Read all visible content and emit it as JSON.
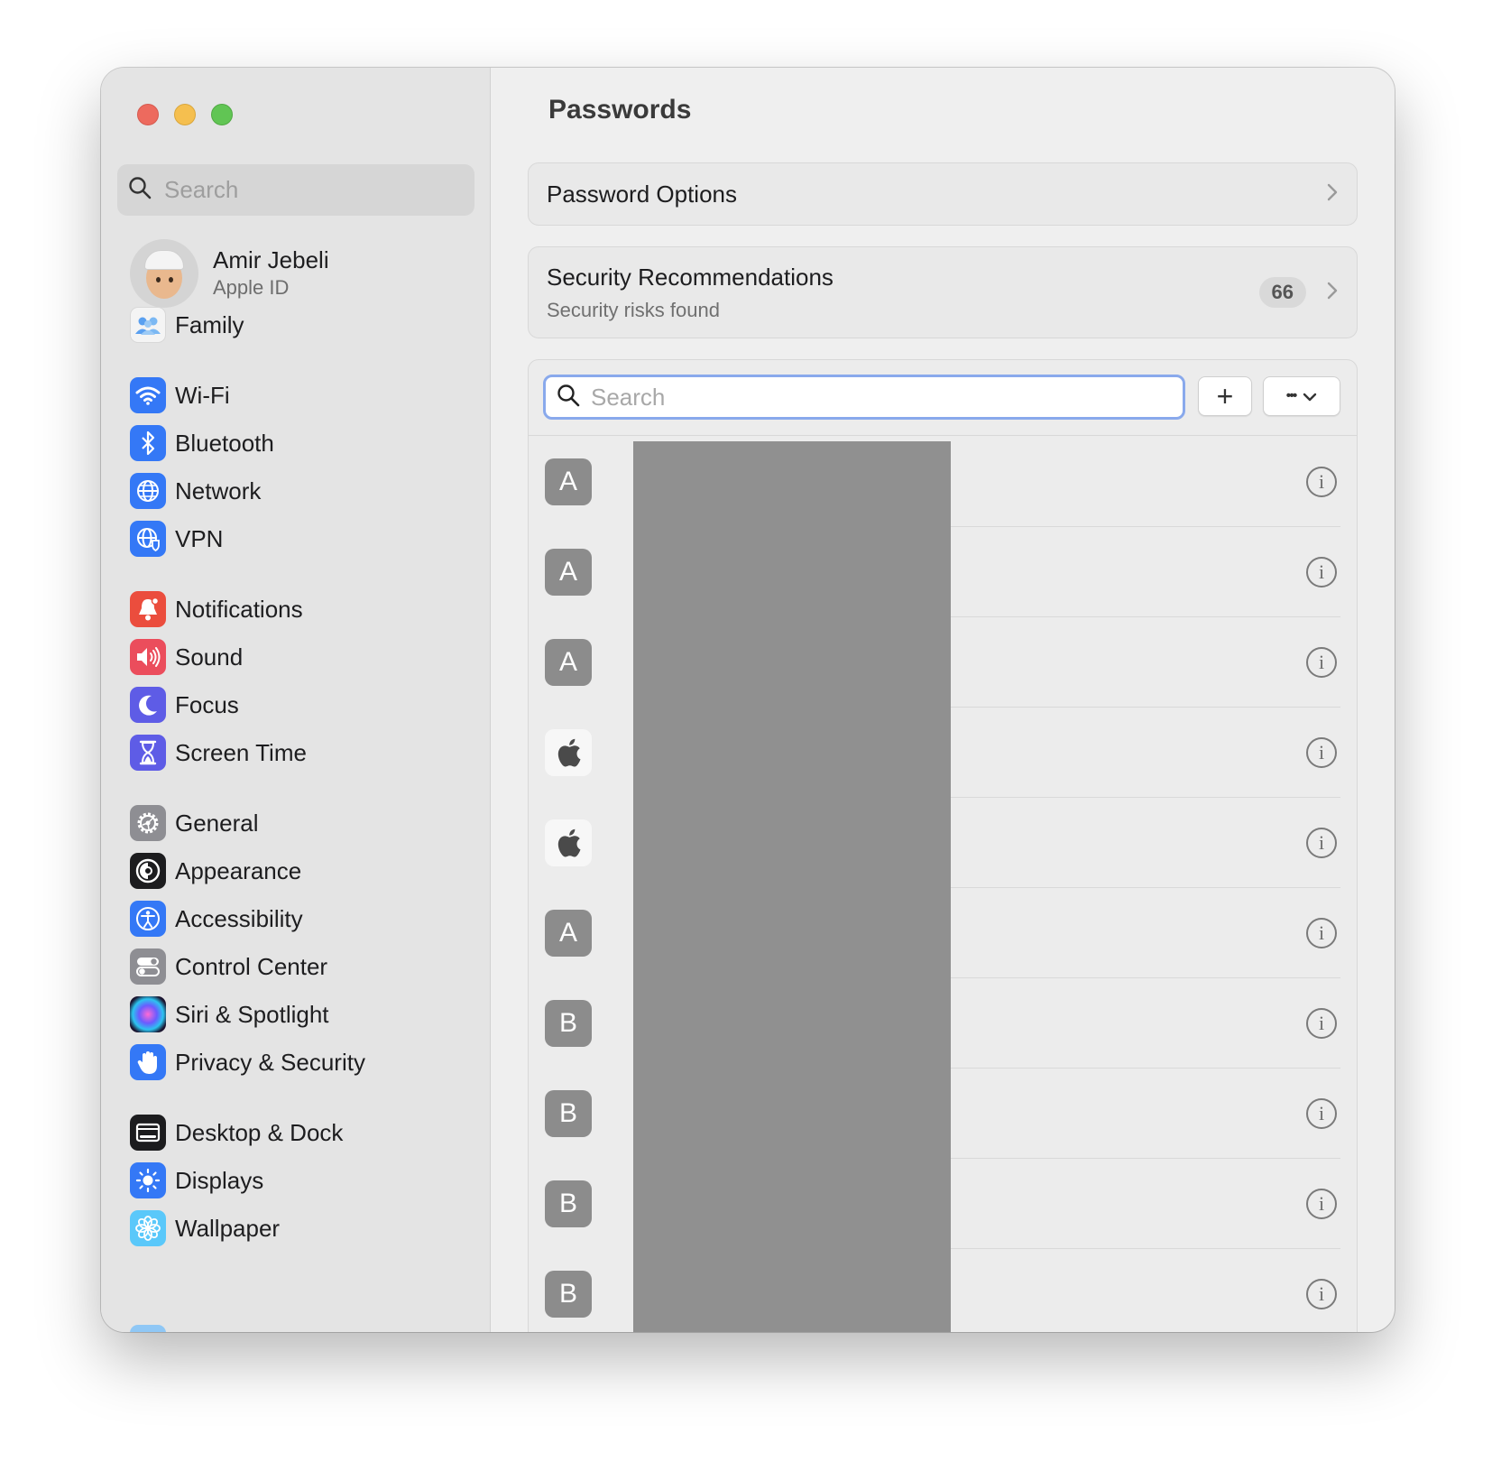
{
  "window": {
    "sidebar": {
      "search_placeholder": "Search",
      "account": {
        "name": "Amir Jebeli",
        "subtitle": "Apple ID"
      },
      "items": [
        {
          "label": "Family",
          "icon": "family-icon",
          "color": "#f2f2f2"
        },
        {
          "label": "Wi-Fi",
          "icon": "wifi-icon",
          "color": "#3478f6"
        },
        {
          "label": "Bluetooth",
          "icon": "bluetooth-icon",
          "color": "#3478f6"
        },
        {
          "label": "Network",
          "icon": "globe-icon",
          "color": "#3478f6"
        },
        {
          "label": "VPN",
          "icon": "vpn-globe-icon",
          "color": "#3478f6"
        },
        {
          "label": "Notifications",
          "icon": "bell-icon",
          "color": "#eb4d3d"
        },
        {
          "label": "Sound",
          "icon": "speaker-icon",
          "color": "#eb4d5c"
        },
        {
          "label": "Focus",
          "icon": "moon-icon",
          "color": "#5e5ce6"
        },
        {
          "label": "Screen Time",
          "icon": "hourglass-icon",
          "color": "#5e5ce6"
        },
        {
          "label": "General",
          "icon": "gear-icon",
          "color": "#8e8e93"
        },
        {
          "label": "Appearance",
          "icon": "appearance-icon",
          "color": "#1c1c1e"
        },
        {
          "label": "Accessibility",
          "icon": "accessibility-icon",
          "color": "#3478f6"
        },
        {
          "label": "Control Center",
          "icon": "toggles-icon",
          "color": "#8e8e93"
        },
        {
          "label": "Siri & Spotlight",
          "icon": "siri-icon",
          "color": "#3a1f5c"
        },
        {
          "label": "Privacy & Security",
          "icon": "hand-icon",
          "color": "#3478f6"
        },
        {
          "label": "Desktop & Dock",
          "icon": "dock-icon",
          "color": "#1c1c1e"
        },
        {
          "label": "Displays",
          "icon": "sun-icon",
          "color": "#3478f6"
        },
        {
          "label": "Wallpaper",
          "icon": "flower-icon",
          "color": "#5ac8fa"
        }
      ]
    },
    "main": {
      "title": "Passwords",
      "password_options": {
        "label": "Password Options"
      },
      "security": {
        "title": "Security Recommendations",
        "subtitle": "Security risks found",
        "count": "66"
      },
      "search_placeholder": "Search",
      "add_label": "+",
      "more_label": "•••",
      "rows": [
        {
          "letter": "A",
          "type": "letter"
        },
        {
          "letter": "A",
          "type": "letter"
        },
        {
          "letter": "A",
          "type": "letter"
        },
        {
          "letter": "",
          "type": "apple"
        },
        {
          "letter": "",
          "type": "apple"
        },
        {
          "letter": "A",
          "type": "letter"
        },
        {
          "letter": "B",
          "type": "letter"
        },
        {
          "letter": "B",
          "type": "letter"
        },
        {
          "letter": "B",
          "type": "letter"
        },
        {
          "letter": "B",
          "type": "letter"
        }
      ]
    }
  }
}
